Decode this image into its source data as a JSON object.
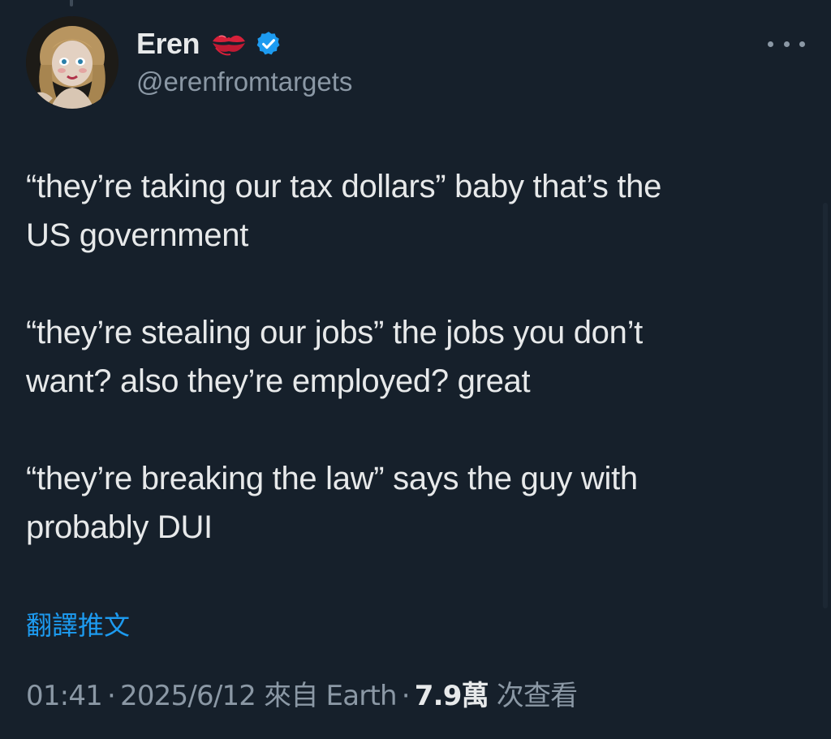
{
  "author": {
    "display_name": "Eren",
    "handle": "@erenfromtargets",
    "name_emoji": "kiss-mark-icon",
    "verified_icon": "verified-badge-icon",
    "verified_color": "#1d9bf0"
  },
  "tweet": {
    "paragraphs": [
      "“they’re taking our tax dollars” baby that’s the\nUS government",
      "“they’re stealing our jobs” the jobs you don’t\nwant? also they’re employed? great",
      "“they’re breaking the law” says the guy with\nprobably DUI"
    ]
  },
  "translate_label": "翻譯推文",
  "meta": {
    "time": "01:41",
    "sep1": "·",
    "date": "2025/6/12",
    "source": "來自 Earth",
    "sep2": "·",
    "views_count": "7.9萬",
    "views_label": "次查看"
  },
  "colors": {
    "background": "#16202b",
    "text": "#e7e9ea",
    "secondary": "#8b98a5",
    "link": "#1d9bf0"
  }
}
